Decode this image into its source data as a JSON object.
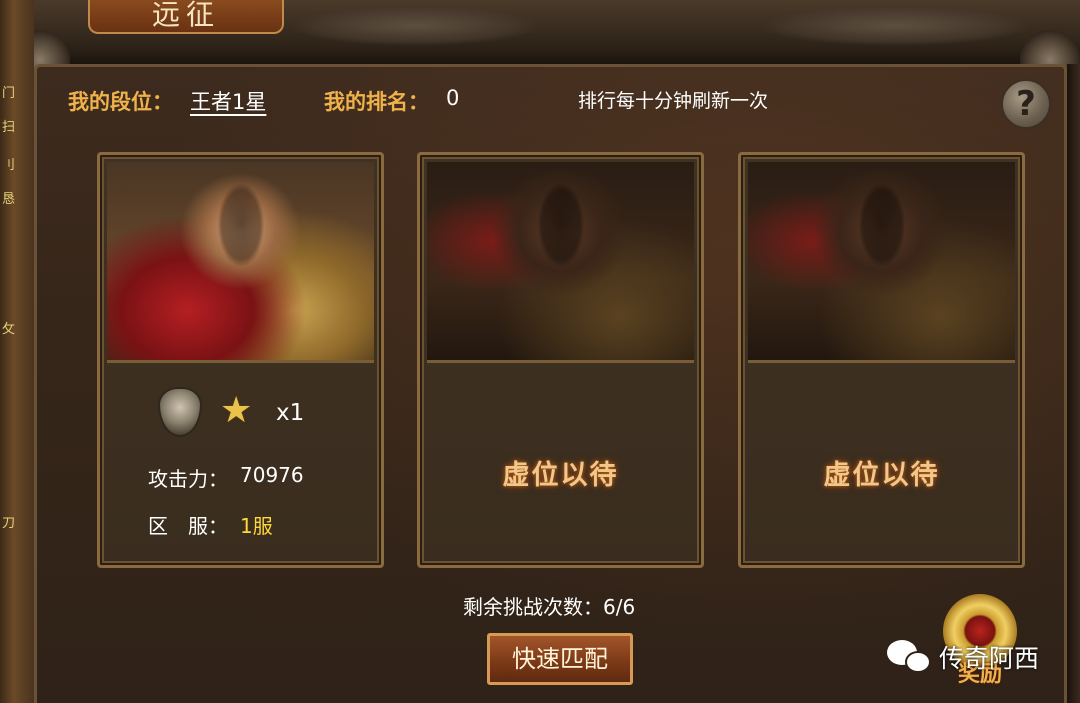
{
  "window": {
    "title": "远征",
    "side_glyphs": [
      "门",
      "扫",
      "刂",
      "恳",
      "攵",
      "刀"
    ]
  },
  "header": {
    "my_tier_label": "我的段位：",
    "my_tier_value": "王者1星",
    "my_rank_label": "我的排名：",
    "my_rank_value": "0",
    "refresh_note": "排行每十分钟刷新一次",
    "help_label": "?"
  },
  "cards": [
    {
      "state": "filled",
      "star_icon": "★",
      "star_count": "x1",
      "attack_label": "攻击力：",
      "attack_value": "70976",
      "server_label": "区　服：",
      "server_value": "1服"
    },
    {
      "state": "vacant",
      "vacant_text": "虚位以待"
    },
    {
      "state": "vacant",
      "vacant_text": "虚位以待"
    }
  ],
  "footer": {
    "remaining_label": "剩余挑战次数：",
    "remaining_value": "6/6",
    "match_button": "快速匹配",
    "reward_label": "奖励",
    "watermark_text": "传奇阿西"
  },
  "colors": {
    "label_gold": "#f0b24a",
    "server_yellow": "#ffd83a",
    "panel_bg": "#3a2a1c"
  }
}
